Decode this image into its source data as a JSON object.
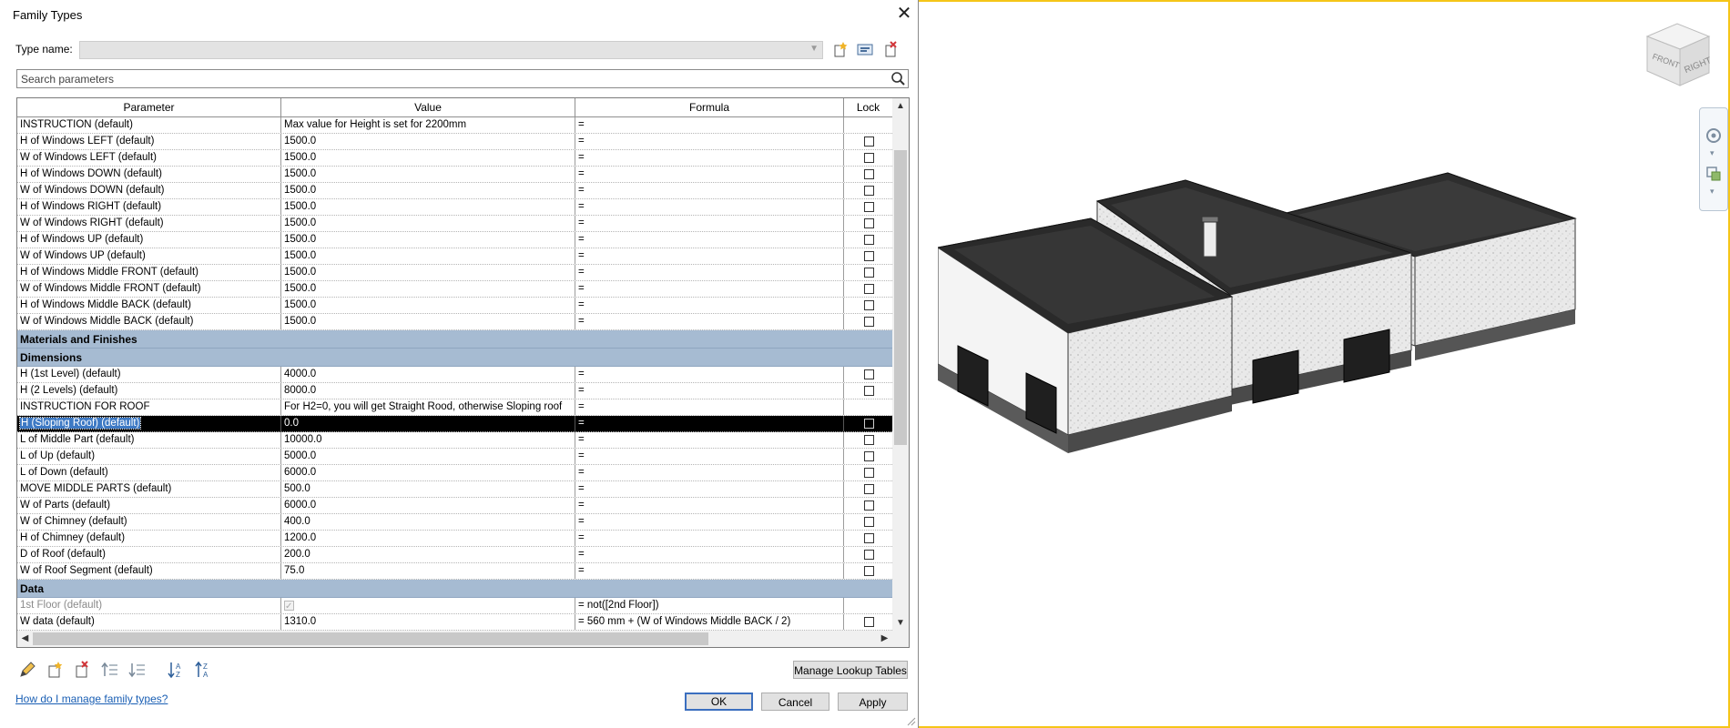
{
  "dialog": {
    "title": "Family Types",
    "type_name_label": "Type name:",
    "type_name_value": "",
    "search_placeholder": "Search parameters",
    "columns": {
      "parameter": "Parameter",
      "value": "Value",
      "formula": "Formula",
      "lock": "Lock"
    }
  },
  "rows": [
    {
      "param": "INSTRUCTION (default)",
      "value": "Max value for Height is set for 2200mm",
      "formula": "=",
      "lock": "none"
    },
    {
      "param": "H of Windows LEFT (default)",
      "value": "1500.0",
      "formula": "=",
      "lock": "unchecked"
    },
    {
      "param": "W of Windows LEFT (default)",
      "value": "1500.0",
      "formula": "=",
      "lock": "unchecked"
    },
    {
      "param": "H of Windows DOWN (default)",
      "value": "1500.0",
      "formula": "=",
      "lock": "unchecked"
    },
    {
      "param": "W of Windows DOWN (default)",
      "value": "1500.0",
      "formula": "=",
      "lock": "unchecked"
    },
    {
      "param": "H of Windows RIGHT (default)",
      "value": "1500.0",
      "formula": "=",
      "lock": "unchecked"
    },
    {
      "param": "W of Windows RIGHT (default)",
      "value": "1500.0",
      "formula": "=",
      "lock": "unchecked"
    },
    {
      "param": "H of Windows  UP (default)",
      "value": "1500.0",
      "formula": "=",
      "lock": "unchecked"
    },
    {
      "param": "W of Windows UP (default)",
      "value": "1500.0",
      "formula": "=",
      "lock": "unchecked"
    },
    {
      "param": "H of Windows Middle FRONT (default)",
      "value": "1500.0",
      "formula": "=",
      "lock": "unchecked"
    },
    {
      "param": "W of Windows Middle FRONT (default)",
      "value": "1500.0",
      "formula": "=",
      "lock": "unchecked"
    },
    {
      "param": "H of Windows Middle BACK (default)",
      "value": "1500.0",
      "formula": "=",
      "lock": "unchecked"
    },
    {
      "param": "W of Windows Middle BACK (default)",
      "value": "1500.0",
      "formula": "=",
      "lock": "unchecked"
    },
    {
      "group": "Materials and Finishes"
    },
    {
      "group": "Dimensions"
    },
    {
      "param": "H (1st Level) (default)",
      "value": "4000.0",
      "formula": "=",
      "lock": "unchecked"
    },
    {
      "param": "H (2 Levels) (default)",
      "value": "8000.0",
      "formula": "=",
      "lock": "unchecked"
    },
    {
      "param": "INSTRUCTION FOR ROOF",
      "value": "For H2=0, you will get Straight Rood, otherwise Sloping roof",
      "formula": "=",
      "lock": "none"
    },
    {
      "param": "H (Sloping Roof) (default)",
      "value": "0.0",
      "formula": "=",
      "lock": "unchecked",
      "selected": true
    },
    {
      "param": "L of Middle Part (default)",
      "value": "10000.0",
      "formula": "=",
      "lock": "unchecked"
    },
    {
      "param": "L of Up (default)",
      "value": "5000.0",
      "formula": "=",
      "lock": "unchecked"
    },
    {
      "param": "L of Down (default)",
      "value": "6000.0",
      "formula": "=",
      "lock": "unchecked"
    },
    {
      "param": "MOVE MIDDLE PARTS (default)",
      "value": "500.0",
      "formula": "=",
      "lock": "unchecked"
    },
    {
      "param": "W of Parts (default)",
      "value": "6000.0",
      "formula": "=",
      "lock": "unchecked"
    },
    {
      "param": "W of Chimney (default)",
      "value": "400.0",
      "formula": "=",
      "lock": "unchecked"
    },
    {
      "param": "H of Chimney (default)",
      "value": "1200.0",
      "formula": "=",
      "lock": "unchecked"
    },
    {
      "param": "D of Roof (default)",
      "value": "200.0",
      "formula": "=",
      "lock": "unchecked"
    },
    {
      "param": "W of Roof Segment (default)",
      "value": "75.0",
      "formula": "=",
      "lock": "unchecked"
    },
    {
      "group": "Data"
    },
    {
      "param": "1st Floor (default)",
      "value": "",
      "value_checkbox": "checked-disabled",
      "formula": "= not([2nd Floor])",
      "lock": "none",
      "disabled": true
    },
    {
      "param": "W data (default)",
      "value": "1310.0",
      "formula": "= 560 mm + (W of Windows Middle BACK / 2)",
      "lock": "unchecked"
    }
  ],
  "buttons": {
    "manage_lookup": "Manage Lookup Tables",
    "ok": "OK",
    "cancel": "Cancel",
    "apply": "Apply"
  },
  "help_link": "How do I manage family types?",
  "view_cube": {
    "front": "FRONT",
    "right": "RIGHT"
  },
  "icons": {
    "new_type": "new-type-icon",
    "rename_type": "rename-type-icon",
    "delete_type": "delete-type-icon",
    "edit_param": "pencil-icon",
    "new_param": "new-parameter-icon",
    "delete_param": "delete-parameter-icon",
    "move_up": "move-up-icon",
    "move_down": "move-down-icon",
    "sort_asc": "sort-ascending-icon",
    "sort_desc": "sort-descending-icon"
  },
  "colors": {
    "group_band": "#a6bbd2",
    "selection": "#000000",
    "viewport_border": "#f5c518",
    "link": "#1a5fb4"
  }
}
